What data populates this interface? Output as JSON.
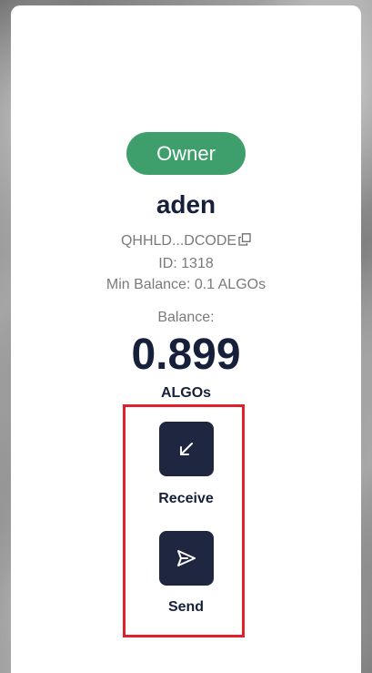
{
  "account": {
    "role_badge": "Owner",
    "name": "aden",
    "address_short": "QHHLD...DCODE",
    "id_text": "ID: 1318",
    "min_balance_text": "Min Balance: 0.1 ALGOs"
  },
  "balance": {
    "label": "Balance:",
    "value": "0.899",
    "unit": "ALGOs"
  },
  "actions": {
    "receive_label": "Receive",
    "send_label": "Send"
  },
  "colors": {
    "badge": "#3f9f6c",
    "primary_text": "#17203a",
    "button_bg": "#1f2740",
    "highlight": "#e0202c"
  },
  "icons": {
    "copy": "copy-icon",
    "receive": "arrow-down-left-icon",
    "send": "paper-plane-icon"
  }
}
